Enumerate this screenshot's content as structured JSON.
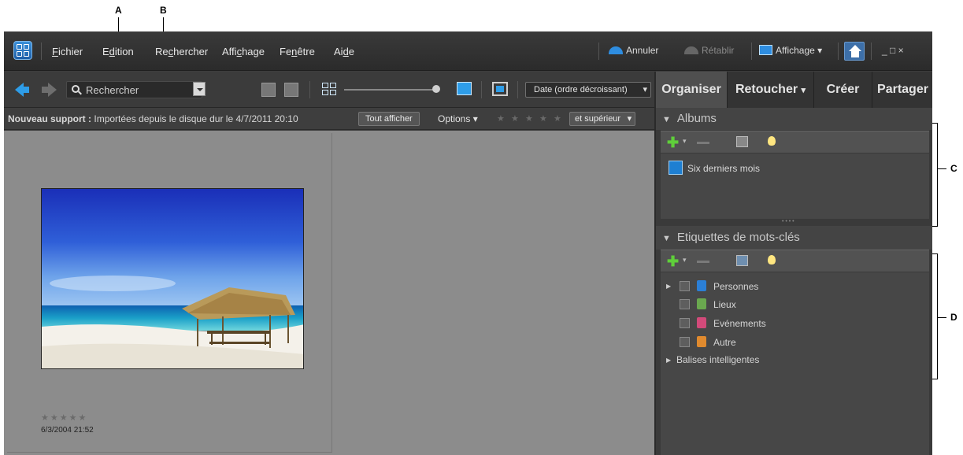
{
  "callouts": {
    "a": "A",
    "b": "B",
    "c": "C",
    "d": "D"
  },
  "menubar": {
    "menus": [
      {
        "label_pre": "",
        "label_u": "F",
        "label_post": "ichier"
      },
      {
        "label_pre": "E",
        "label_u": "d",
        "label_post": "ition"
      },
      {
        "label_pre": "Re",
        "label_u": "c",
        "label_post": "hercher"
      },
      {
        "label_pre": "Affi",
        "label_u": "c",
        "label_post": "hage"
      },
      {
        "label_pre": "Fe",
        "label_u": "n",
        "label_post": "être"
      },
      {
        "label_pre": "Ai",
        "label_u": "d",
        "label_post": "e"
      }
    ],
    "undo_label": "Annuler",
    "redo_label": "Rétablir",
    "display_label": "Affichage",
    "window_controls": "_ □ ×"
  },
  "toolbar": {
    "search_placeholder": "Rechercher",
    "sort_label": "Date (ordre décroissant)"
  },
  "infobar": {
    "prefix": "Nouveau support :",
    "text": "Importées depuis le disque dur le 4/7/2011 20:10",
    "show_all": "Tout afficher",
    "options": "Options",
    "rating_stars": "★",
    "rating_filter": "et supérieur"
  },
  "thumbnail": {
    "stars": "★★★★★",
    "date": "6/3/2004 21:52"
  },
  "panel": {
    "tabs": [
      "Organiser",
      "Retoucher",
      "Créer",
      "Partager"
    ],
    "tab_retoucher_suffix": "▾",
    "albums_header": "Albums",
    "albums": [
      "Six derniers mois"
    ],
    "keywords_header": "Etiquettes de mots-clés",
    "keywords": [
      "Personnes",
      "Lieux",
      "Evénements",
      "Autre"
    ],
    "smart_tags": "Balises intelligentes",
    "divider_dots": "• • • •"
  },
  "colors": {
    "accent": "#1e7fd2",
    "plus_green": "#5fcf3a",
    "tag_people": "#2b7fd6",
    "tag_places": "#6aa84f",
    "tag_events": "#d24a7a",
    "tag_other": "#e08a2e"
  }
}
